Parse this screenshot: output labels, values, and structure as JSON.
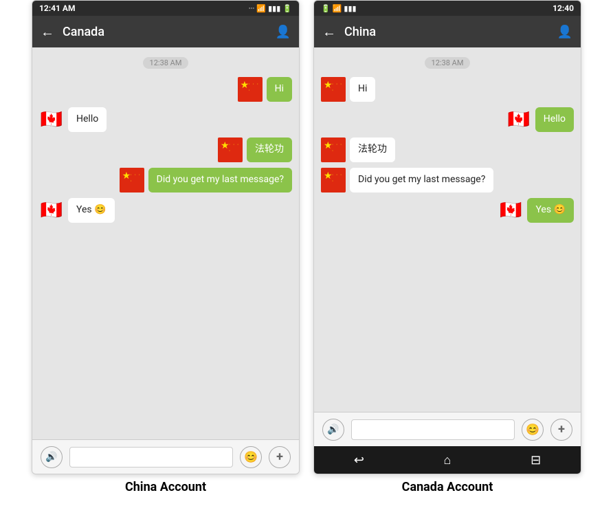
{
  "left_phone": {
    "status_bar": {
      "time": "12:41 AM",
      "icons": "... ⊛ ▲ ▮▮ ▬"
    },
    "top_bar": {
      "back": "←",
      "title": "Canada",
      "profile": "👤"
    },
    "timestamp": "12:38 AM",
    "messages": [
      {
        "id": "m1",
        "side": "right",
        "text": "Hi",
        "flag": "china",
        "bubble": "green"
      },
      {
        "id": "m2",
        "side": "left",
        "text": "Hello",
        "flag": "canada",
        "bubble": "white"
      },
      {
        "id": "m3",
        "side": "right",
        "text": "法轮功",
        "flag": "china",
        "bubble": "green"
      },
      {
        "id": "m4",
        "side": "right",
        "text": "Did you get my last message?",
        "flag": "china",
        "bubble": "green"
      },
      {
        "id": "m5",
        "side": "left",
        "text": "Yes 😊",
        "flag": "canada",
        "bubble": "white"
      }
    ],
    "bottom_bar": {
      "voice": "🔊",
      "placeholder": "",
      "emoji": "😊",
      "plus": "+"
    },
    "caption": "China Account"
  },
  "right_phone": {
    "status_bar": {
      "time": "12:40",
      "icons": "▬ ⊛ ▲ ▮▮"
    },
    "top_bar": {
      "back": "←",
      "title": "China",
      "profile": "👤"
    },
    "timestamp": "12:38 AM",
    "messages": [
      {
        "id": "m1",
        "side": "left",
        "text": "Hi",
        "flag": "china",
        "bubble": "white"
      },
      {
        "id": "m2",
        "side": "right",
        "text": "Hello",
        "flag": "canada",
        "bubble": "green"
      },
      {
        "id": "m3",
        "side": "left",
        "text": "法轮功",
        "flag": "china",
        "bubble": "white"
      },
      {
        "id": "m4",
        "side": "left",
        "text": "Did you get my last message?",
        "flag": "china",
        "bubble": "white"
      },
      {
        "id": "m5",
        "side": "right",
        "text": "Yes 😊",
        "flag": "canada",
        "bubble": "green"
      }
    ],
    "bottom_bar": {
      "voice": "🔊",
      "placeholder": "",
      "emoji": "😊",
      "plus": "+"
    },
    "nav_bar": {
      "back": "↩",
      "home": "⌂",
      "recent": "⊟"
    },
    "caption": "Canada Account"
  }
}
